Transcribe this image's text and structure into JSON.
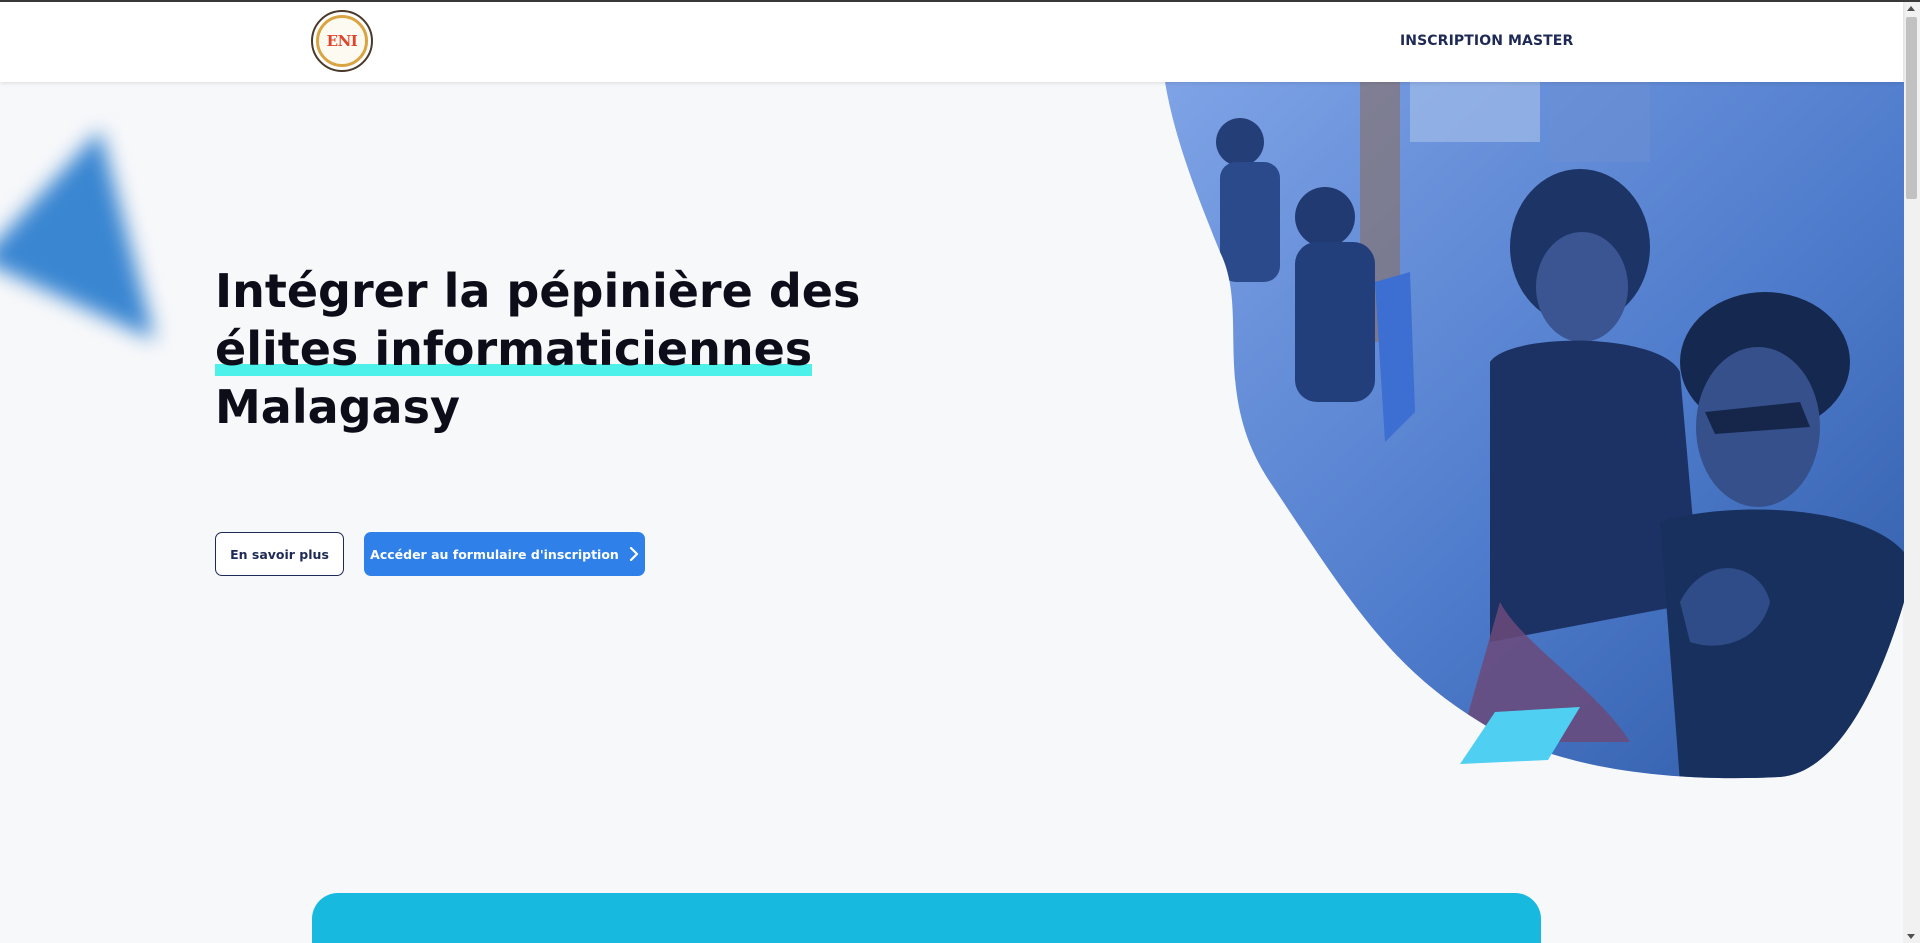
{
  "navbar": {
    "logo_icon": "eni-seal-logo",
    "logo_text": "ENI",
    "links": [
      {
        "label": "INSCRIPTION MASTER"
      }
    ]
  },
  "hero": {
    "title_lines": [
      "Intégrer la pépinière des",
      "élites informaticiennes",
      "Malagasy"
    ],
    "highlight_color": "#4ef0ea",
    "secondary_button": "En savoir plus",
    "primary_button": "Accéder au formulaire d'inscription",
    "primary_button_icon": "chevron-right-icon",
    "image_description_icon": "students-at-computer-photo"
  },
  "colors": {
    "brand_dark": "#1e2a55",
    "primary": "#2f80e9",
    "accent_cyan": "#17b9df",
    "background": "#f7f8fa"
  }
}
